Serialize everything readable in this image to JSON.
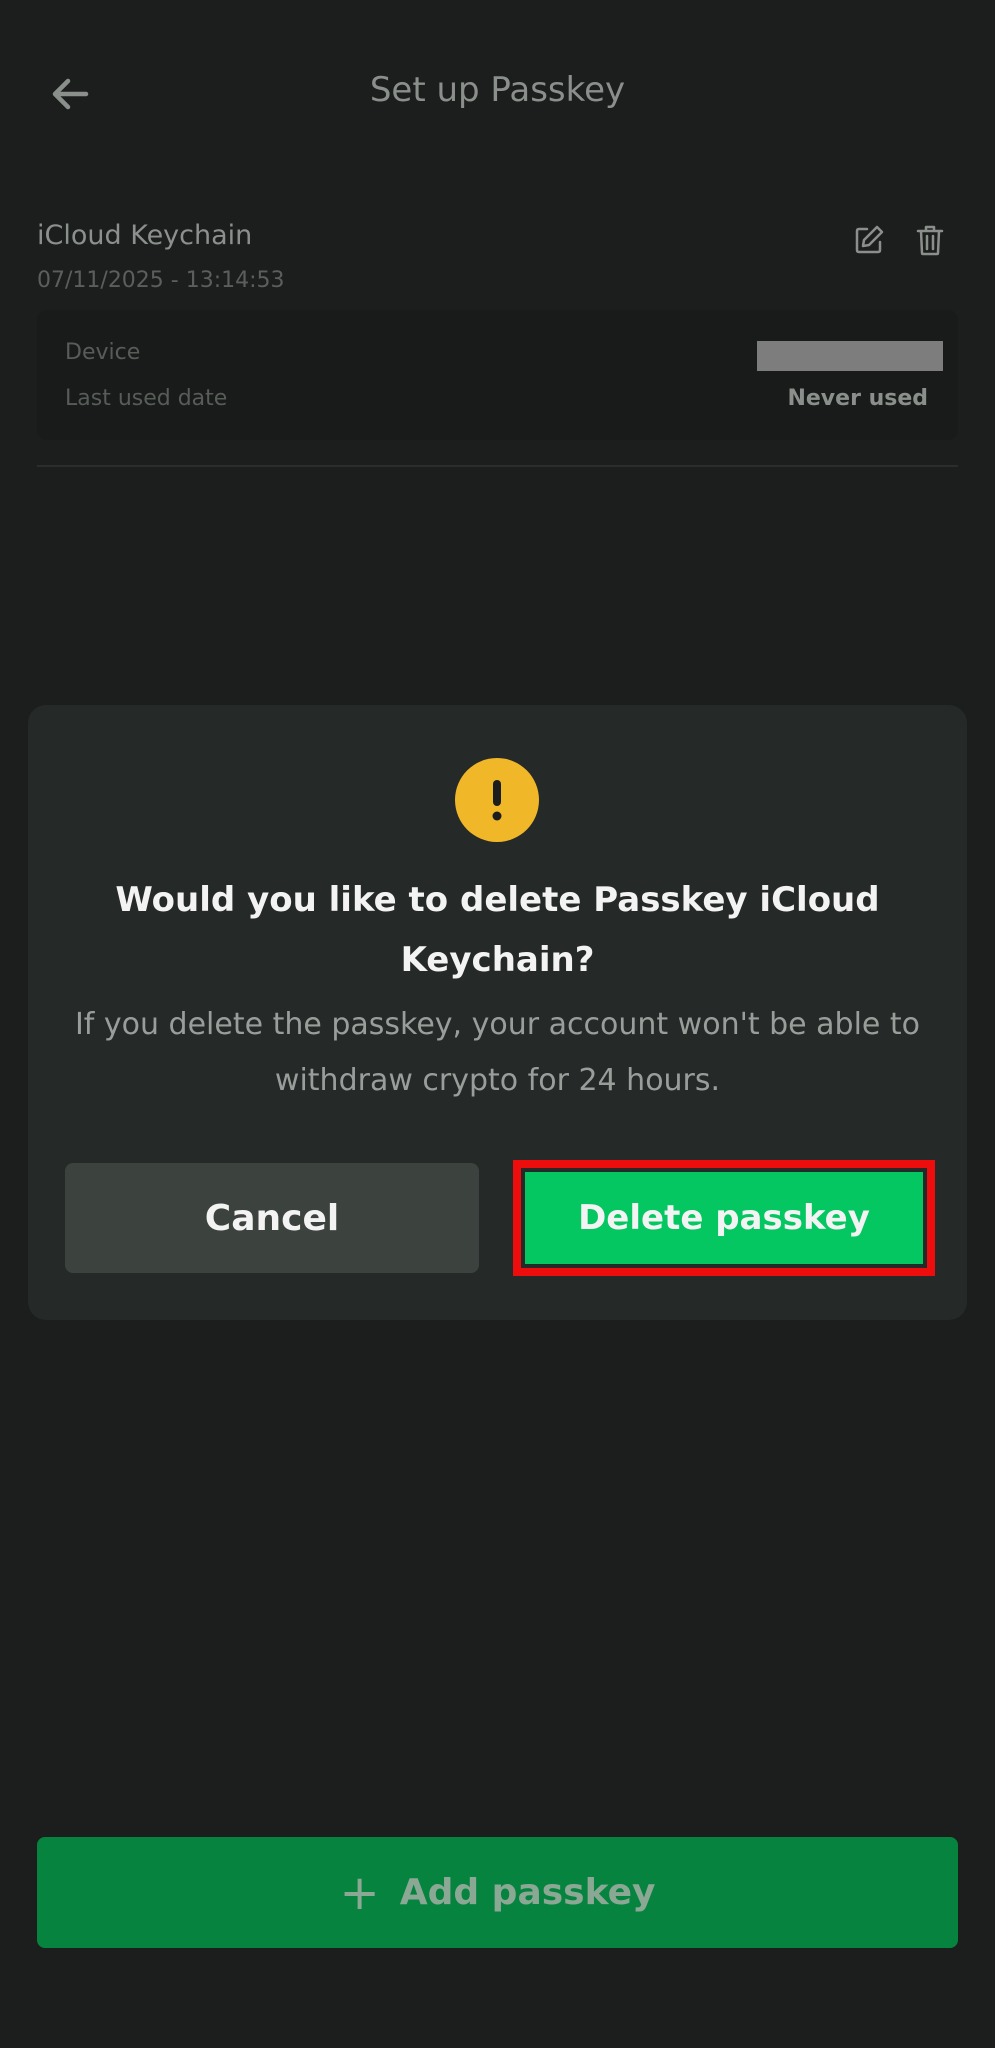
{
  "header": {
    "title": "Set up Passkey",
    "back_icon": "arrow-left-icon"
  },
  "passkey": {
    "name": "iCloud Keychain",
    "created": "07/11/2025 - 13:14:53",
    "edit_icon": "edit-icon",
    "delete_icon": "trash-icon",
    "device_label": "Device",
    "last_used_label": "Last used date",
    "last_used_value": "Never used"
  },
  "dialog": {
    "icon": "warning-icon",
    "title": "Would you like to delete Passkey iCloud Keychain?",
    "message": "If you delete the passkey, your account won't be able to withdraw crypto for 24 hours.",
    "cancel_label": "Cancel",
    "delete_label": "Delete passkey"
  },
  "footer": {
    "add_label": "Add passkey",
    "add_icon": "+"
  },
  "colors": {
    "background": "#1b1e1c",
    "dialog": "#252927",
    "accent_green": "#04c761",
    "warning": "#f0b829",
    "highlight": "#ee0d0d"
  }
}
